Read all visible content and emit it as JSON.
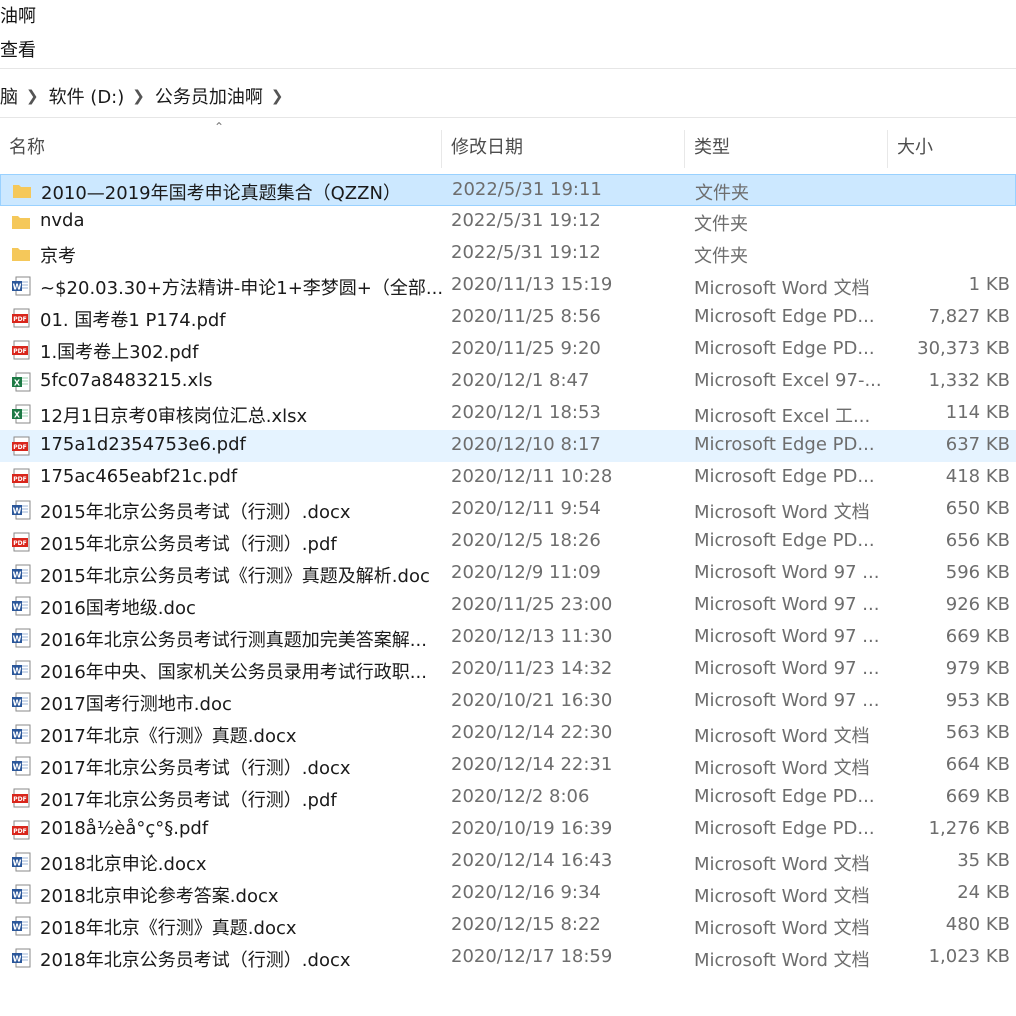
{
  "window": {
    "title_fragment": "油啊"
  },
  "ribbon": {
    "view_tab": "查看"
  },
  "address_bar": {
    "crumbs": [
      "脑",
      "软件 (D:)",
      "公务员加油啊"
    ]
  },
  "columns": {
    "name": "名称",
    "date": "修改日期",
    "type": "类型",
    "size": "大小"
  },
  "colors": {
    "selected_bg": "#cce8ff",
    "hover_bg": "#e5f3ff",
    "folder": "#f5c85a",
    "word": "#2b579a",
    "pdf": "#d9261c",
    "excel": "#1d7a45"
  },
  "files": [
    {
      "icon": "folder-icon",
      "name": "2010—2019年国考申论真题集合（QZZN）",
      "date": "2022/5/31 19:11",
      "type": "文件夹",
      "size": ""
    },
    {
      "icon": "folder-icon",
      "name": "nvda",
      "date": "2022/5/31 19:12",
      "type": "文件夹",
      "size": ""
    },
    {
      "icon": "folder-icon",
      "name": "京考",
      "date": "2022/5/31 19:12",
      "type": "文件夹",
      "size": ""
    },
    {
      "icon": "word-doc-icon",
      "name": "~$20.03.30+方法精讲-申论1+李梦圆+（全部...",
      "date": "2020/11/13 15:19",
      "type": "Microsoft Word 文档",
      "size": "1 KB"
    },
    {
      "icon": "pdf-icon",
      "name": "01. 国考卷1 P174.pdf",
      "date": "2020/11/25 8:56",
      "type": "Microsoft Edge PD...",
      "size": "7,827 KB"
    },
    {
      "icon": "pdf-icon",
      "name": "1.国考卷上302.pdf",
      "date": "2020/11/25 9:20",
      "type": "Microsoft Edge PD...",
      "size": "30,373 KB"
    },
    {
      "icon": "excel-icon",
      "name": "5fc07a8483215.xls",
      "date": "2020/12/1 8:47",
      "type": "Microsoft Excel 97-...",
      "size": "1,332 KB"
    },
    {
      "icon": "excel-icon",
      "name": "12月1日京考0审核岗位汇总.xlsx",
      "date": "2020/12/1 18:53",
      "type": "Microsoft Excel 工...",
      "size": "114 KB"
    },
    {
      "icon": "pdf-icon",
      "name": "175a1d2354753e6.pdf",
      "date": "2020/12/10 8:17",
      "type": "Microsoft Edge PD...",
      "size": "637 KB"
    },
    {
      "icon": "pdf-icon",
      "name": "175ac465eabf21c.pdf",
      "date": "2020/12/11 10:28",
      "type": "Microsoft Edge PD...",
      "size": "418 KB"
    },
    {
      "icon": "word-doc-icon",
      "name": "2015年北京公务员考试（行测）.docx",
      "date": "2020/12/11 9:54",
      "type": "Microsoft Word 文档",
      "size": "650 KB"
    },
    {
      "icon": "pdf-icon",
      "name": "2015年北京公务员考试（行测）.pdf",
      "date": "2020/12/5 18:26",
      "type": "Microsoft Edge PD...",
      "size": "656 KB"
    },
    {
      "icon": "word-doc-icon",
      "name": "2015年北京公务员考试《行测》真题及解析.doc",
      "date": "2020/12/9 11:09",
      "type": "Microsoft Word 97 ...",
      "size": "596 KB"
    },
    {
      "icon": "word-doc-icon",
      "name": "2016国考地级.doc",
      "date": "2020/11/25 23:00",
      "type": "Microsoft Word 97 ...",
      "size": "926 KB"
    },
    {
      "icon": "word-doc-icon",
      "name": "2016年北京公务员考试行测真题加完美答案解...",
      "date": "2020/12/13 11:30",
      "type": "Microsoft Word 97 ...",
      "size": "669 KB"
    },
    {
      "icon": "word-doc-icon",
      "name": "2016年中央、国家机关公务员录用考试行政职...",
      "date": "2020/11/23 14:32",
      "type": "Microsoft Word 97 ...",
      "size": "979 KB"
    },
    {
      "icon": "word-doc-icon",
      "name": "2017国考行测地市.doc",
      "date": "2020/10/21 16:30",
      "type": "Microsoft Word 97 ...",
      "size": "953 KB"
    },
    {
      "icon": "word-doc-icon",
      "name": "2017年北京《行测》真题.docx",
      "date": "2020/12/14 22:30",
      "type": "Microsoft Word 文档",
      "size": "563 KB"
    },
    {
      "icon": "word-doc-icon",
      "name": "2017年北京公务员考试（行测）.docx",
      "date": "2020/12/14 22:31",
      "type": "Microsoft Word 文档",
      "size": "664 KB"
    },
    {
      "icon": "pdf-icon",
      "name": "2017年北京公务员考试（行测）.pdf",
      "date": "2020/12/2 8:06",
      "type": "Microsoft Edge PD...",
      "size": "669 KB"
    },
    {
      "icon": "pdf-icon",
      "name": "2018å½èå°ç°§.pdf",
      "date": "2020/10/19 16:39",
      "type": "Microsoft Edge PD...",
      "size": "1,276 KB"
    },
    {
      "icon": "word-doc-icon",
      "name": "2018北京申论.docx",
      "date": "2020/12/14 16:43",
      "type": "Microsoft Word 文档",
      "size": "35 KB"
    },
    {
      "icon": "word-doc-icon",
      "name": "2018北京申论参考答案.docx",
      "date": "2020/12/16 9:34",
      "type": "Microsoft Word 文档",
      "size": "24 KB"
    },
    {
      "icon": "word-doc-icon",
      "name": "2018年北京《行测》真题.docx",
      "date": "2020/12/15 8:22",
      "type": "Microsoft Word 文档",
      "size": "480 KB"
    },
    {
      "icon": "word-doc-icon",
      "name": "2018年北京公务员考试（行测）.docx",
      "date": "2020/12/17 18:59",
      "type": "Microsoft Word 文档",
      "size": "1,023 KB"
    }
  ]
}
